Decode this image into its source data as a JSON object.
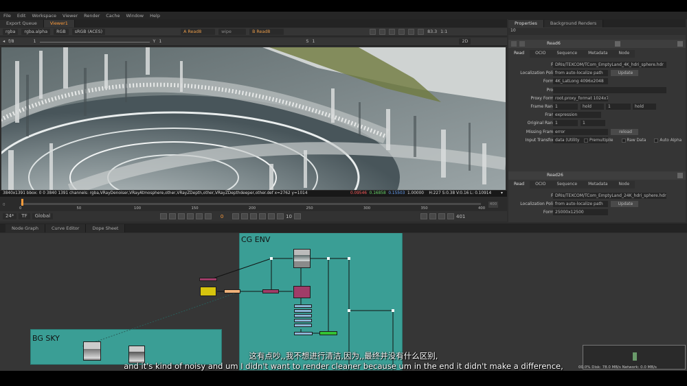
{
  "menu": [
    "File",
    "Edit",
    "Workspace",
    "Viewer",
    "Render",
    "Cache",
    "Window",
    "Help"
  ],
  "viewer_tabs": [
    {
      "label": "Export Queue",
      "active": false
    },
    {
      "label": "Viewer1",
      "active": true
    }
  ],
  "viewer_toolbar": {
    "channels": "rgba",
    "alpha": "rgba.alpha",
    "colorspace_mode": "RGB",
    "display": "sRGB (ACES)",
    "input_a": "A  Read8",
    "wipe": "wipe",
    "input_b": "B  Read8",
    "zoom": "83.3",
    "ratio": "1:1",
    "view": "2D"
  },
  "viewer_toolbar2": {
    "fstop": "f/8",
    "fstop_val": "1",
    "gamma_label": "Y",
    "gamma_val": "1",
    "sat_label": "S",
    "sat_val": "1"
  },
  "status": {
    "left": "3840x1391  bbox: 0 0 3840 1391 channels: rgba,VRayDenoiser,VRayAtmosphere,other,VRayZDepth,other,VRayZDepthdeeper,other.def  x=2762 y=1014",
    "r": "0.09546",
    "g": "0.16858",
    "b": "0.15503",
    "a": "1.00000",
    "hsv": "H:227 S:0.38 V:0.16  L: 0.10914"
  },
  "timeline": {
    "ticks": [
      "0",
      "50",
      "100",
      "150",
      "200",
      "250",
      "300",
      "350",
      "400"
    ],
    "in_field": "0",
    "out_field": "400"
  },
  "transport": {
    "fps": "24*",
    "tf": "TF",
    "scope": "Global",
    "frame": "0",
    "step": "10",
    "end_frame": "401"
  },
  "props_tabs": [
    "Properties",
    "Background Renders"
  ],
  "props_count": "10",
  "read6": {
    "name": "Read6",
    "tabs": [
      "Read",
      "OCIO",
      "Sequence",
      "Metadata",
      "Node"
    ],
    "rows": [
      {
        "label": "File",
        "value": "DRIs/TEXCOM/TCom_EmptyLand_4K_hdri_sphere.hdr"
      },
      {
        "label": "Localization Policy",
        "value": "from auto-localize path",
        "extra": "Update"
      },
      {
        "label": "Format",
        "value": "4K_LatLong 4096x2048"
      },
      {
        "label": "Proxy",
        "value": ""
      },
      {
        "label": "Proxy Format",
        "value": "root.proxy_format 1024x778"
      },
      {
        "label": "Frame Range",
        "value": "1",
        "hold1": "hold",
        "end": "1",
        "hold2": "hold"
      },
      {
        "label": "Frame",
        "value": "expression"
      },
      {
        "label": "Original Range",
        "value": "1",
        "end": "1"
      },
      {
        "label": "Missing Frames",
        "value": "error",
        "extra": "reload"
      },
      {
        "label": "Input Transform",
        "value": "data (Utility"
      }
    ],
    "checkboxes": [
      "Premultiplie",
      "Raw Data",
      "Auto Alpha"
    ]
  },
  "read26": {
    "name": "Read26",
    "tabs": [
      "Read",
      "OCIO",
      "Sequence",
      "Metadata",
      "Node"
    ],
    "rows": [
      {
        "label": "File",
        "value": "DRIs/TEXCOM/TCom_EmptyLand_24K_hdri_sphere.hdr"
      },
      {
        "label": "Localization Policy",
        "value": "from auto-localize path",
        "extra": "Update"
      },
      {
        "label": "Format",
        "value": "25000x12500"
      }
    ]
  },
  "graph_tabs": [
    "Node Graph",
    "Curve Editor",
    "Dope Sheet"
  ],
  "backdrops": {
    "cg_env": "CG ENV",
    "bg_sky": "BG SKY"
  },
  "minimap_status": "00.0%  Disk: 78.0 MB/s  Network: 0.0 MB/s",
  "subtitles": {
    "zh": "这有点吵,,我不想进行清洁,因为,,最终并没有什么区别,",
    "en": "and it's kind of noisy and um I didn't want to render cleaner because um in the end it didn't make a difference,"
  },
  "colors": {
    "accent": "#ff9c3b",
    "backdrop": "#3a9e95",
    "node_magenta": "#a03c68",
    "node_yellow": "#d6c40e",
    "node_peach": "#f0b27a",
    "node_green": "#33c233",
    "node_blue": "#8bb5d6"
  }
}
